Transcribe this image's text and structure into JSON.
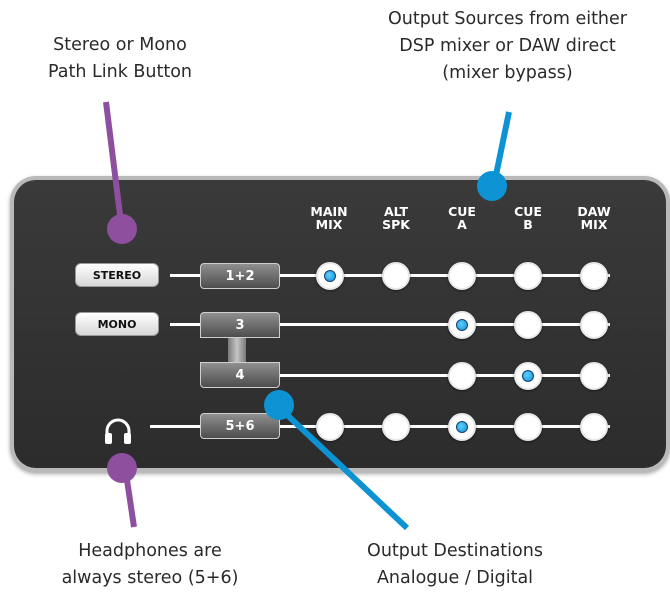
{
  "callouts": {
    "link_button": "Stereo or Mono\nPath Link Button",
    "output_sources": "Output Sources from either\nDSP mixer or DAW direct\n(mixer bypass)",
    "headphones": "Headphones are\nalways stereo (5+6)",
    "output_destinations": "Output Destinations\nAnalogue / Digital"
  },
  "columns": [
    "MAIN\nMIX",
    "ALT\nSPK",
    "CUE\nA",
    "CUE\nB",
    "DAW\nMIX"
  ],
  "link_buttons": {
    "stereo": "STEREO",
    "mono": "MONO"
  },
  "outputs": [
    "1+2",
    "3",
    "4",
    "5+6"
  ],
  "routing": {
    "row_1_2": "MAIN MIX",
    "row_3": "CUE A",
    "row_4": "CUE B",
    "row_5_6": "CUE A"
  },
  "colors": {
    "panel": "#2f2f2f",
    "active_led": "#1ea7e8",
    "pointer_purple": "#8e4f9e",
    "pointer_blue": "#0d93d4"
  },
  "icons": [
    "headphones-icon"
  ]
}
